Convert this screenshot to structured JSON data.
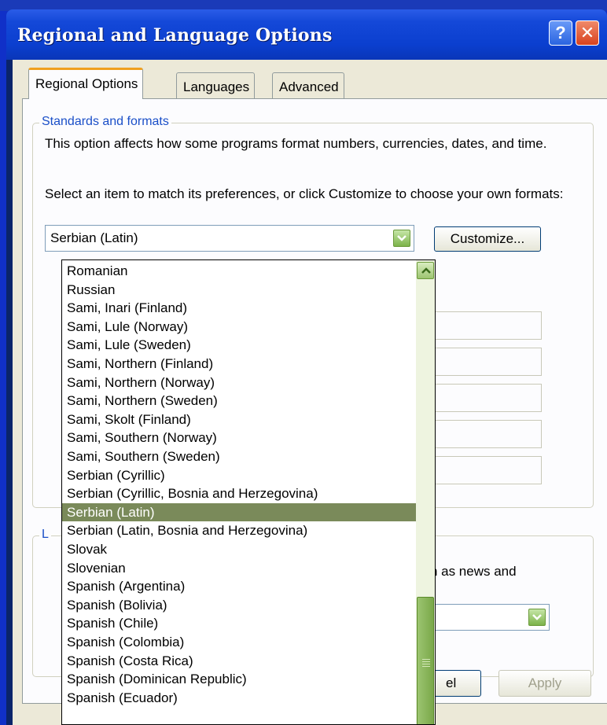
{
  "window": {
    "title": "Regional and Language Options",
    "help_glyph": "?",
    "close_glyph": "✕"
  },
  "tabs": [
    {
      "label": "Regional Options",
      "active": true
    },
    {
      "label": "Languages",
      "active": false
    },
    {
      "label": "Advanced",
      "active": false
    }
  ],
  "standards": {
    "group_label": "Standards and formats",
    "description": "This option affects how some programs format numbers, currencies, dates, and time.",
    "instruction": "Select an item to match its preferences, or click Customize to choose your own formats:",
    "selected_value": "Serbian (Latin)",
    "customize_label": "Customize..."
  },
  "location": {
    "group_label_partial": "L",
    "description_partial": "uch as news and"
  },
  "dropdown": {
    "items": [
      "Romanian",
      "Russian",
      "Sami, Inari (Finland)",
      "Sami, Lule (Norway)",
      "Sami, Lule (Sweden)",
      "Sami, Northern (Finland)",
      "Sami, Northern (Norway)",
      "Sami, Northern (Sweden)",
      "Sami, Skolt (Finland)",
      "Sami, Southern (Norway)",
      "Sami, Southern (Sweden)",
      "Serbian (Cyrillic)",
      "Serbian (Cyrillic, Bosnia and Herzegovina)",
      "Serbian (Latin)",
      "Serbian (Latin, Bosnia and Herzegovina)",
      "Slovak",
      "Slovenian",
      "Spanish (Argentina)",
      "Spanish (Bolivia)",
      "Spanish (Chile)",
      "Spanish (Colombia)",
      "Spanish (Costa Rica)",
      "Spanish (Dominican Republic)",
      "Spanish (Ecuador)"
    ],
    "selected_index": 13
  },
  "footer": {
    "cancel_partial": "el",
    "apply_label": "Apply"
  },
  "colors": {
    "selection": "#7a8a5a",
    "titlebar": "#0b3fcf",
    "group_label": "#1a4fc8",
    "accent_tab": "#f0a020"
  }
}
